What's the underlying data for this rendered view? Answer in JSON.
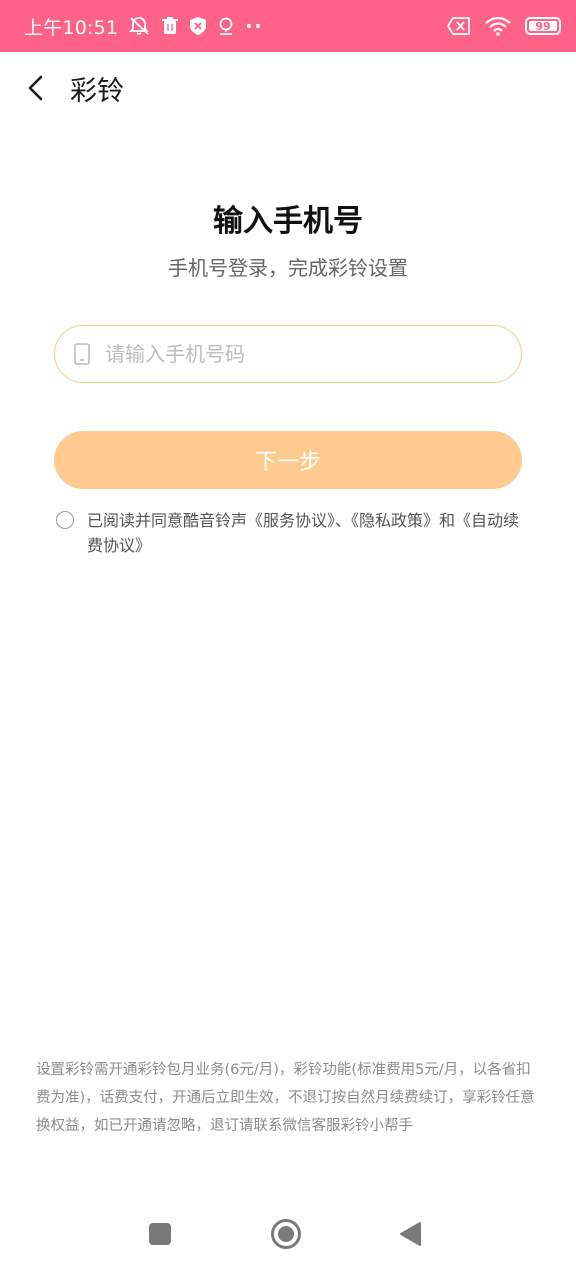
{
  "status_bar": {
    "time": "上午10:51",
    "icons_left": [
      "mute-bell-icon",
      "trash-icon",
      "shield-icon",
      "location-icon",
      "more-dots-icon"
    ],
    "icons_right": [
      "sim-off-icon",
      "wifi-icon",
      "battery-icon"
    ],
    "battery_level": "99",
    "background_color": "#ff6287"
  },
  "header": {
    "title": "彩铃"
  },
  "main": {
    "title": "输入手机号",
    "subtitle": "手机号登录，完成彩铃设置",
    "phone_input": {
      "placeholder": "请输入手机号码",
      "value": ""
    },
    "next_button_label": "下一步",
    "next_button_color": "#ffca8f",
    "agreement_text": "已阅读并同意酷音铃声《服务协议》、《隐私政策》和《自动续费协议》",
    "agreement_checked": false
  },
  "footer": {
    "note": "设置彩铃需开通彩铃包月业务(6元/月)，彩铃功能(标准费用5元/月，以各省扣费为准)，话费支付，开通后立即生效，不退订按自然月续费续订，享彩铃任意换权益，如已开通请忽略，退订请联系微信客服彩铃小帮手"
  },
  "nav_bar": {
    "buttons": [
      "recent-apps-icon",
      "home-icon",
      "back-triangle-icon"
    ]
  }
}
